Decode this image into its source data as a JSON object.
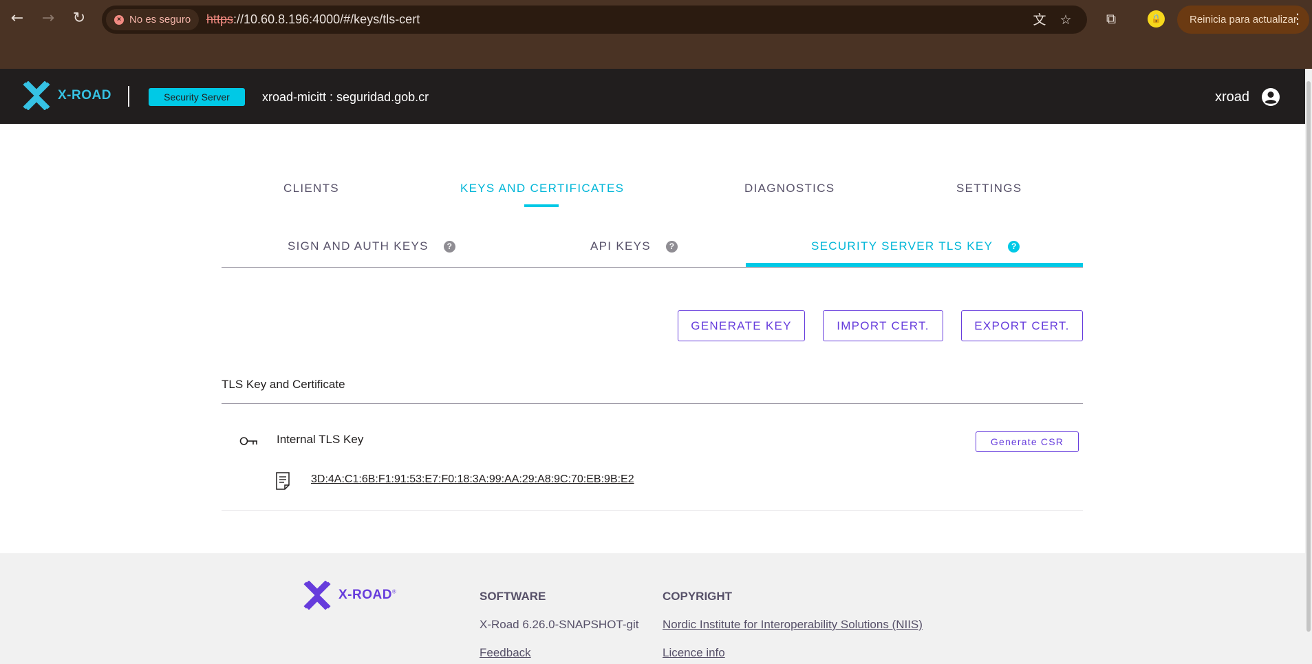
{
  "browser": {
    "security_chip": "No es seguro",
    "url_scheme": "https",
    "url_rest": "://10.60.8.196:4000/#/keys/tls-cert",
    "update_button": "Reinicia para actualizar",
    "back_icon": "←",
    "forward_icon": "→",
    "reload_icon": "↻",
    "translate_icon": "文",
    "star_icon": "☆",
    "extensions_icon": "⧉",
    "menu_icon": "⋮"
  },
  "header": {
    "logo_text": "X-ROAD",
    "server_badge": "Security Server",
    "server_name": "xroad-micitt : seguridad.gob.cr",
    "user_name": "xroad"
  },
  "main_tabs": [
    {
      "label": "CLIENTS",
      "active": false
    },
    {
      "label": "KEYS AND CERTIFICATES",
      "active": true
    },
    {
      "label": "DIAGNOSTICS",
      "active": false
    },
    {
      "label": "SETTINGS",
      "active": false
    }
  ],
  "sub_tabs": [
    {
      "label": "SIGN AND AUTH KEYS",
      "help": "?"
    },
    {
      "label": "API KEYS",
      "help": "?"
    },
    {
      "label": "SECURITY SERVER TLS KEY",
      "help": "?",
      "active": true
    }
  ],
  "actions": {
    "generate_key": "GENERATE KEY",
    "import_cert": "IMPORT CERT.",
    "export_cert": "EXPORT CERT."
  },
  "tls_section": {
    "title": "TLS Key and Certificate",
    "key_name": "Internal TLS Key",
    "generate_csr": "Generate CSR",
    "cert_hash": "3D:4A:C1:6B:F1:91:53:E7:F0:18:3A:99:AA:29:A8:9C:70:EB:9B:E2"
  },
  "footer": {
    "logo_text": "X-ROAD",
    "software_heading": "SOFTWARE",
    "software_version": "X-Road 6.26.0-SNAPSHOT-git",
    "feedback_link": "Feedback",
    "copyright_heading": "COPYRIGHT",
    "copyright_org": "Nordic Institute for Interoperability Solutions (NIIS)",
    "licence_link": "Licence info"
  },
  "colors": {
    "accent_cyan": "#00c9e6",
    "accent_purple": "#663cdc",
    "header_bg": "#211e1e",
    "browser_bg": "#4a3324"
  }
}
